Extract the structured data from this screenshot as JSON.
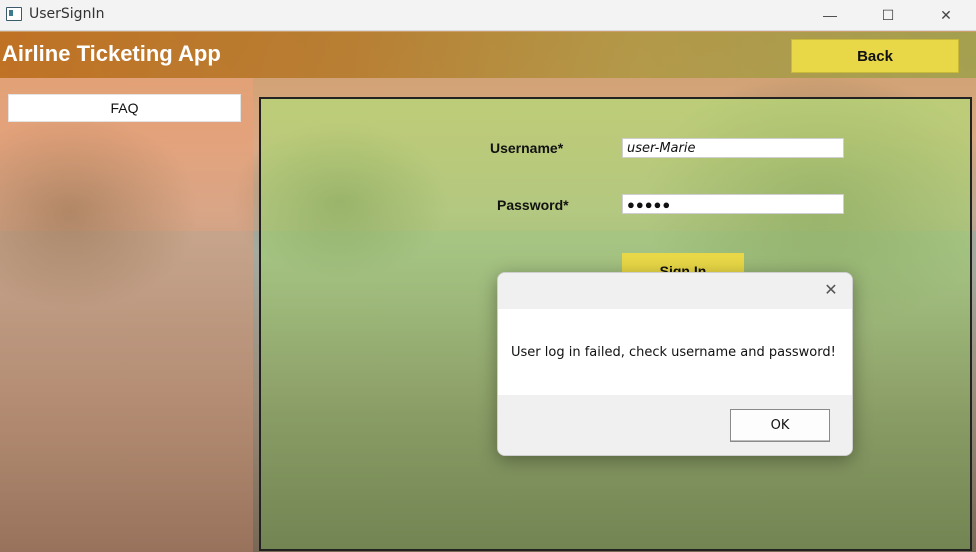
{
  "window": {
    "title": "UserSignIn",
    "minimize_glyph": "—",
    "maximize_glyph": "☐",
    "close_glyph": "✕"
  },
  "header": {
    "app_title": "Airline Ticketing App",
    "back_label": "Back"
  },
  "sidebar": {
    "faq_label": "FAQ"
  },
  "form": {
    "username_label": "Username*",
    "username_value": "user-Marie",
    "password_label": "Password*",
    "password_masked": "●●●●●",
    "signin_label": "Sign In"
  },
  "dialog": {
    "message": "User log in failed, check username and password!",
    "ok_label": "OK",
    "close_glyph": "✕"
  },
  "colors": {
    "accent_yellow": "#e8d746",
    "form_panel_green": "#b2dc78",
    "sidebar_peach": "#f0a078",
    "header_orange": "#be6e1e"
  }
}
